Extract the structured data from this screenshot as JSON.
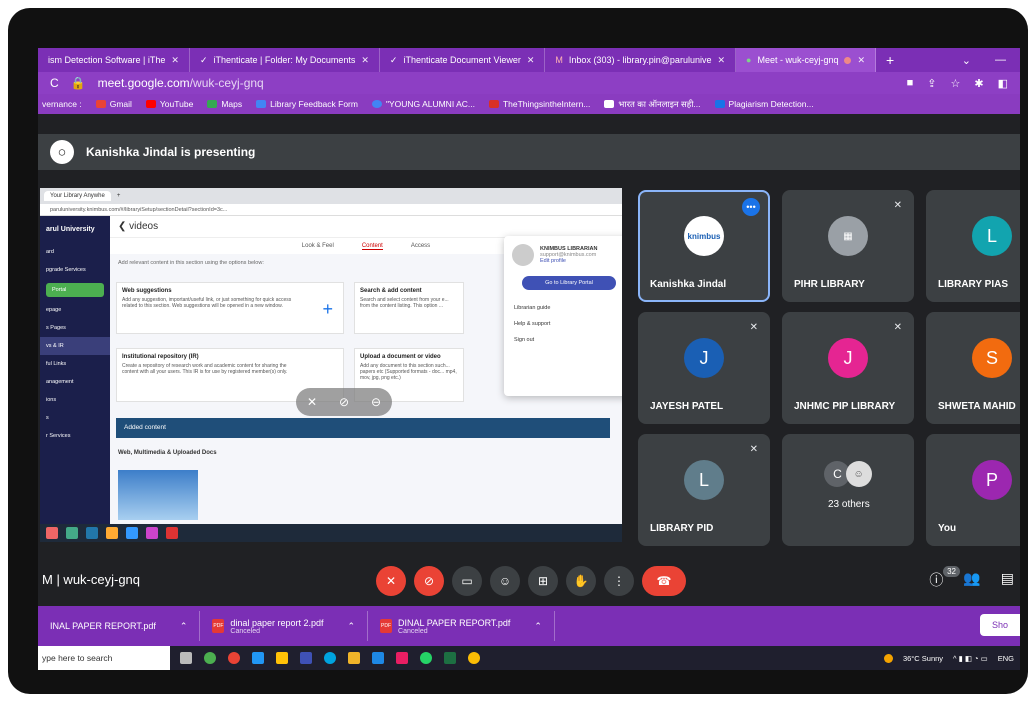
{
  "browser": {
    "tabs": [
      {
        "label": "ism Detection Software | iThe",
        "active": false
      },
      {
        "label": "iThenticate | Folder: My Documents",
        "active": false
      },
      {
        "label": "iThenticate Document Viewer",
        "active": false
      },
      {
        "label": "Inbox (303) - library.pin@parulunive",
        "active": false
      },
      {
        "label": "Meet - wuk-ceyj-gnq",
        "active": true
      }
    ],
    "url_host": "meet.google.com",
    "url_path": "/wuk-ceyj-gnq",
    "bookmarks": [
      {
        "label": "vernance :",
        "color": "#888888"
      },
      {
        "label": "Gmail",
        "color": "#ea4335"
      },
      {
        "label": "YouTube",
        "color": "#ff0000"
      },
      {
        "label": "Maps",
        "color": "#34a853"
      },
      {
        "label": "Library Feedback Form",
        "color": "#4285f4"
      },
      {
        "label": "\"YOUNG ALUMNI AC...",
        "color": "#4285f4"
      },
      {
        "label": "TheThingsintheIntern...",
        "color": "#d93025"
      },
      {
        "label": "भारत का ऑनलाइन सही...",
        "color": "#ffffff"
      },
      {
        "label": "Plagiarism Detection...",
        "color": "#1a73e8"
      }
    ]
  },
  "meet": {
    "presenting_text": "Kanishka Jindal is presenting",
    "meeting_code": "M | wuk-ceyj-gnq",
    "participants_count": "32",
    "tiles": [
      {
        "name": "Kanishka Jindal",
        "initial": "knimbus",
        "color": "#ffffff",
        "muted": false
      },
      {
        "name": "PIHR LIBRARY",
        "initial": "",
        "color": "#9aa0a6",
        "muted": true
      },
      {
        "name": "LIBRARY PIAS",
        "initial": "L",
        "color": "#12a4af",
        "muted": true
      },
      {
        "name": "JAYESH PATEL",
        "initial": "J",
        "color": "#1a5fb4",
        "muted": true
      },
      {
        "name": "JNHMC PIP LIBRARY",
        "initial": "J",
        "color": "#e52592",
        "muted": true
      },
      {
        "name": "SHWETA MAHID",
        "initial": "S",
        "color": "#f26b0f",
        "muted": false
      },
      {
        "name": "LIBRARY PID",
        "initial": "L",
        "color": "#607d8b",
        "muted": true
      },
      {
        "name": "23 others",
        "initial": "C",
        "color": "#5f6368",
        "muted": false
      },
      {
        "name": "You",
        "initial": "P",
        "color": "#9c27b0",
        "muted": false
      }
    ]
  },
  "shared": {
    "inner_tab": "Your Library Anywhe",
    "inner_url": "paruluniversity.knimbus.com/#/libraryiSetup/sectionDetail?sectionId=3c...",
    "brand": "arul University",
    "side_items": [
      "ard",
      "pgrade Services",
      "Portal",
      "epage",
      "s Pages",
      "vs & IR",
      "ful Links",
      "anagement",
      "ions",
      "s",
      "r Services"
    ],
    "page_title": "videos",
    "page_tabs": [
      "Look & Feel",
      "Content",
      "Access"
    ],
    "hint": "Add relevant content in this section using the options below:",
    "card1_title": "Web suggestions",
    "card1_text": "Add any suggestion, important/useful link, or just something for quick access related to this section. Web suggestions will be opened in a new window.",
    "card2_title": "Search & add content",
    "card2_text": "Search and select content from your e... from the content listing. This option ...",
    "card3_title": "Institutional repository (IR)",
    "card3_text": "Create a repository of research work and academic content for sharing the content with all your users. This IR is for use by registered member(s) only.",
    "card4_title": "Upload a document or video",
    "card4_text": "Add any document to this section such... papers etc (Supported formats - doc... mp4, mov, jpg, png etc.)",
    "added": "Added content",
    "wm": "Web, Multimedia & Uploaded Docs",
    "popup_name": "KNIMBUS LIBRARIAN",
    "popup_email": "support@knimbus.com",
    "popup_edit": "Edit profile",
    "popup_btn": "Go to Library Portal",
    "popup_items": [
      "Librarian guide",
      "Help & support",
      "Sign out"
    ]
  },
  "downloads": [
    {
      "name": "INAL PAPER REPORT.pdf",
      "status": ""
    },
    {
      "name": "dinal paper report 2.pdf",
      "status": "Canceled"
    },
    {
      "name": "DINAL PAPER REPORT.pdf",
      "status": "Canceled"
    }
  ],
  "show_all": "Sho",
  "taskbar": {
    "search": "ype here to search",
    "weather": "36°C Sunny",
    "lang": "ENG"
  }
}
